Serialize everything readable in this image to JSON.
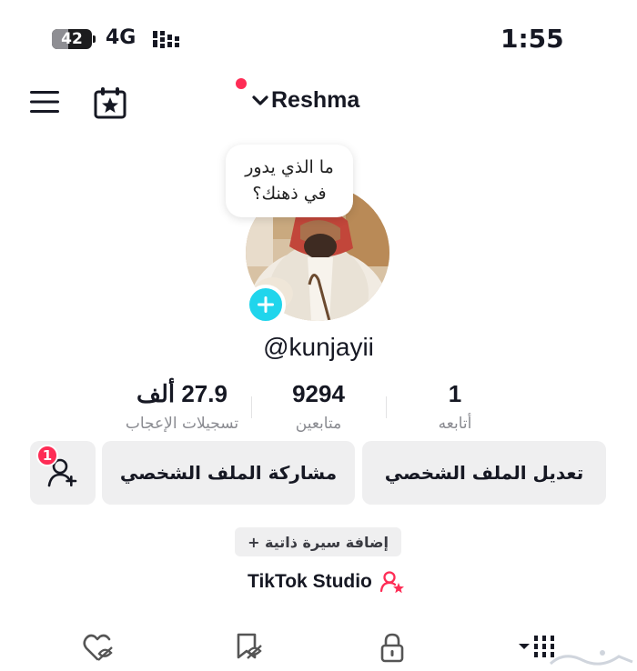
{
  "status_bar": {
    "battery_level": "42",
    "network": "4G",
    "time": "1:55"
  },
  "header": {
    "username": "Reshma",
    "has_notification": true
  },
  "profile": {
    "thought_bubble": "ما الذي يدور في ذهنك؟",
    "handle": "@kunjayii",
    "stats": [
      {
        "value": "1",
        "label": "أتابعه"
      },
      {
        "value": "9294",
        "label": "متابعين"
      },
      {
        "value": "27.9 ألف",
        "label": "تسجيلات الإعجاب"
      }
    ]
  },
  "actions": {
    "edit_profile": "تعديل الملف الشخصي",
    "share_profile": "مشاركة الملف الشخصي",
    "add_friend_badge": "1"
  },
  "bio_button": "+ إضافة سيرة ذاتية",
  "studio_label": "TikTok Studio",
  "bottom_tabs": [
    {
      "icon": "grid-icon",
      "has_dropdown": true
    },
    {
      "icon": "lock-icon"
    },
    {
      "icon": "bookmark-icon"
    },
    {
      "icon": "liked-icon"
    }
  ],
  "colors": {
    "accent": "#fe2c55",
    "avatar_add": "#20d5ec",
    "button_bg": "#efeff0",
    "muted_text": "#8a8b91"
  }
}
